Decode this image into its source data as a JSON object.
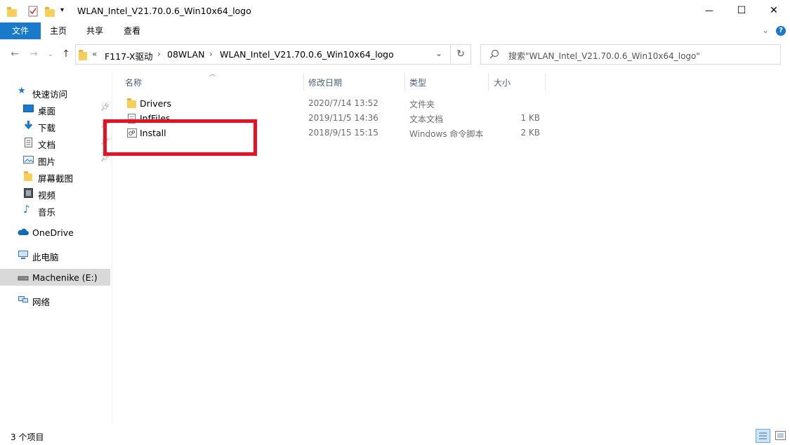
{
  "window": {
    "title": "WLAN_Intel_V21.70.0.6_Win10x64_logo",
    "minimize": "—",
    "maximize": "☐",
    "close": "✕"
  },
  "ribbon": {
    "tabs": [
      "文件",
      "主页",
      "共享",
      "查看"
    ],
    "expand_icon": "chevron-down",
    "help": "?"
  },
  "address": {
    "overflow": "«",
    "crumbs": [
      "F117-X驱动",
      "08WLAN",
      "WLAN_Intel_V21.70.0.6_Win10x64_logo"
    ],
    "refresh": "↻"
  },
  "search": {
    "placeholder": "搜索\"WLAN_Intel_V21.70.0.6_Win10x64_logo\""
  },
  "sidebar": {
    "quick_access": "快速访问",
    "quick_items": [
      {
        "label": "桌面",
        "icon": "desktop-icon",
        "pinned": true
      },
      {
        "label": "下载",
        "icon": "download-icon",
        "pinned": true
      },
      {
        "label": "文档",
        "icon": "document-icon",
        "pinned": true
      },
      {
        "label": "图片",
        "icon": "picture-icon",
        "pinned": true
      },
      {
        "label": "屏幕截图",
        "icon": "folder-icon",
        "pinned": false
      },
      {
        "label": "视频",
        "icon": "video-icon",
        "pinned": false
      },
      {
        "label": "音乐",
        "icon": "music-icon",
        "pinned": false
      }
    ],
    "onedrive": "OneDrive",
    "this_pc": "此电脑",
    "drive": "Machenike (E:)",
    "network": "网络"
  },
  "columns": {
    "name": "名称",
    "date": "修改日期",
    "type": "类型",
    "size": "大小"
  },
  "files": [
    {
      "name": "Drivers",
      "date": "2020/7/14 13:52",
      "type": "文件夹",
      "size": "",
      "icon": "folder-icon"
    },
    {
      "name": "InfFiles",
      "date": "2019/11/5 14:36",
      "type": "文本文档",
      "size": "1 KB",
      "icon": "text-file-icon"
    },
    {
      "name": "Install",
      "date": "2018/9/15 15:15",
      "type": "Windows 命令脚本",
      "size": "2 KB",
      "icon": "script-file-icon"
    }
  ],
  "highlight_color": "#e81123",
  "status": {
    "count": "3 个项目"
  }
}
